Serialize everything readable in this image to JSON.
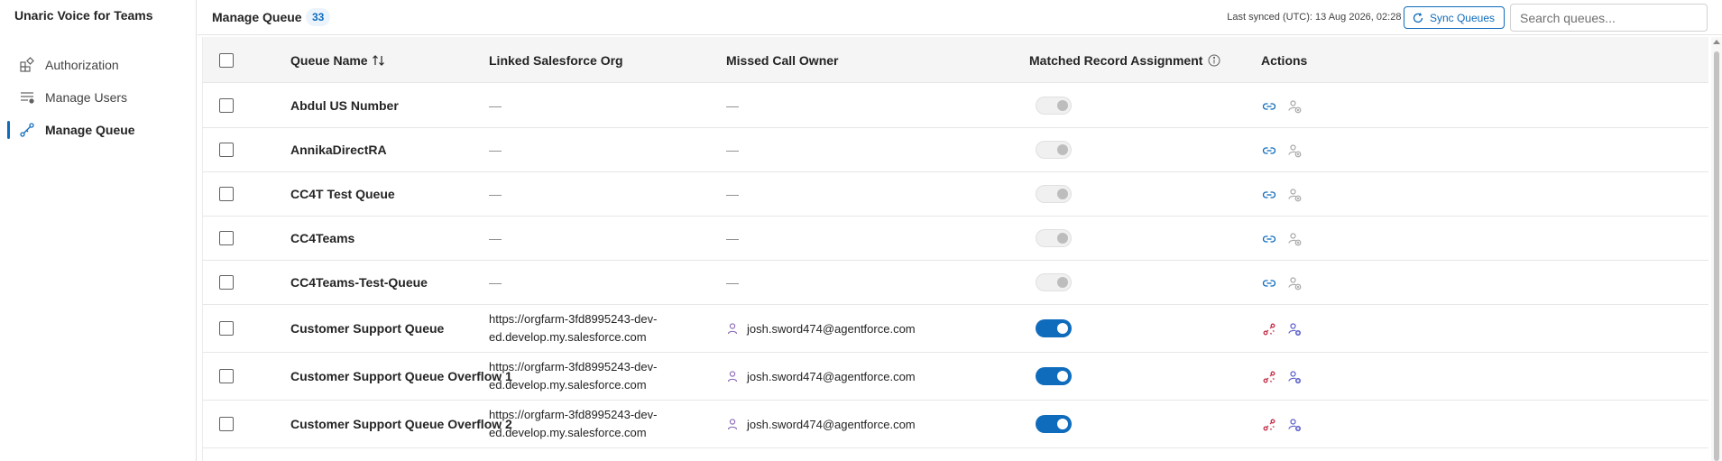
{
  "app": {
    "title": "Unaric Voice for Teams"
  },
  "sidebar": {
    "items": [
      {
        "label": "Authorization",
        "icon": "apps-icon",
        "active": false
      },
      {
        "label": "Manage Users",
        "icon": "user-list-icon",
        "active": false
      },
      {
        "label": "Manage Queue",
        "icon": "queue-flow-icon",
        "active": true
      }
    ]
  },
  "header": {
    "title": "Manage Queue",
    "count": "33",
    "last_synced": "Last synced (UTC): 13 Aug 2026, 02:28 PM",
    "sync_label": "Sync Queues",
    "search_placeholder": "Search queues..."
  },
  "table": {
    "columns": {
      "name": "Queue Name",
      "org": "Linked Salesforce Org",
      "owner": "Missed Call Owner",
      "assignment": "Matched Record Assignment",
      "actions": "Actions"
    },
    "rows": [
      {
        "name": "Abdul US Number",
        "org": "—",
        "owner": "—",
        "assignment": false,
        "linked": false
      },
      {
        "name": "AnnikaDirectRA",
        "org": "—",
        "owner": "—",
        "assignment": false,
        "linked": false
      },
      {
        "name": "CC4T Test Queue",
        "org": "—",
        "owner": "—",
        "assignment": false,
        "linked": false
      },
      {
        "name": "CC4Teams",
        "org": "—",
        "owner": "—",
        "assignment": false,
        "linked": false
      },
      {
        "name": "CC4Teams-Test-Queue",
        "org": "—",
        "owner": "—",
        "assignment": false,
        "linked": false
      },
      {
        "name": "Customer Support Queue",
        "org": "https://orgfarm-3fd8995243-dev-ed.develop.my.salesforce.com",
        "owner": "josh.sword474@agentforce.com",
        "assignment": true,
        "linked": true
      },
      {
        "name": "Customer Support Queue Overflow 1",
        "org": "https://orgfarm-3fd8995243-dev-ed.develop.my.salesforce.com",
        "owner": "josh.sword474@agentforce.com",
        "assignment": true,
        "linked": true
      },
      {
        "name": "Customer Support Queue Overflow 2",
        "org": "https://orgfarm-3fd8995243-dev-ed.develop.my.salesforce.com",
        "owner": "josh.sword474@agentforce.com",
        "assignment": true,
        "linked": true
      }
    ]
  },
  "colors": {
    "accent": "#0f6cbd",
    "unlink": "#c4314b",
    "owner_icon": "#8764b8"
  }
}
